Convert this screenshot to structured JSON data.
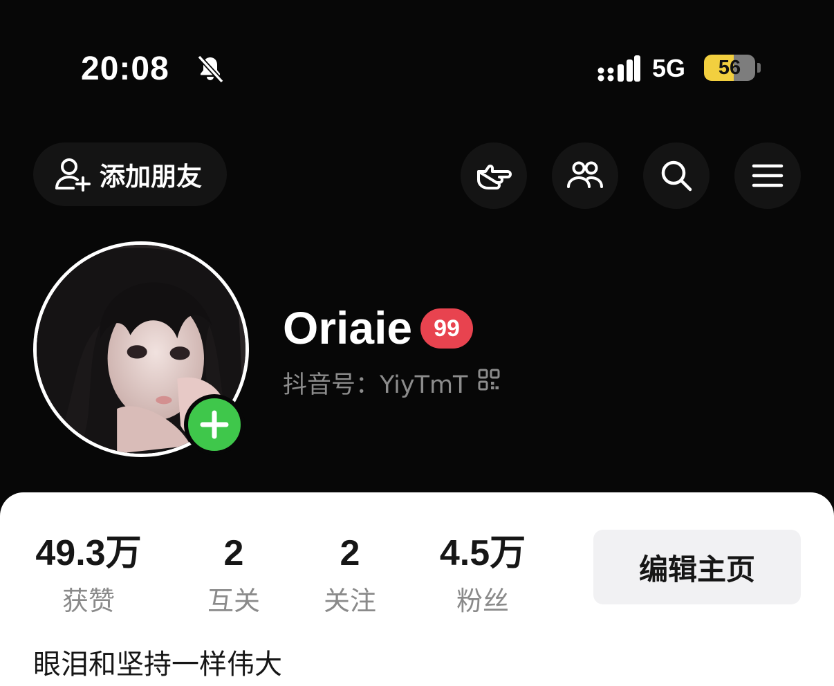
{
  "status_bar": {
    "time": "20:08",
    "network": "5G",
    "battery": "56",
    "icons": [
      "bell-muted-icon",
      "signal-icon"
    ]
  },
  "top_bar": {
    "add_friend_label": "添加朋友",
    "icons": [
      "add-user-icon",
      "pointing-hand-icon",
      "people-icon",
      "search-icon",
      "menu-icon"
    ]
  },
  "profile": {
    "username": "Oriaie",
    "level_badge": "99",
    "douyin_id": "抖音号：YiyTmT",
    "icons": [
      "avatar-add-icon",
      "qr-code-icon"
    ]
  },
  "stats": [
    {
      "value": "49.3万",
      "label": "获赞"
    },
    {
      "value": "2",
      "label": "互关"
    },
    {
      "value": "2",
      "label": "关注"
    },
    {
      "value": "4.5万",
      "label": "粉丝"
    }
  ],
  "edit_button": "编辑主页",
  "bio": "眼泪和坚持一样伟大",
  "colors": {
    "background_dark": "#070707",
    "badge_red": "#e8434f",
    "add_green": "#3fc74b",
    "battery_yellow": "#f2cf3f"
  }
}
